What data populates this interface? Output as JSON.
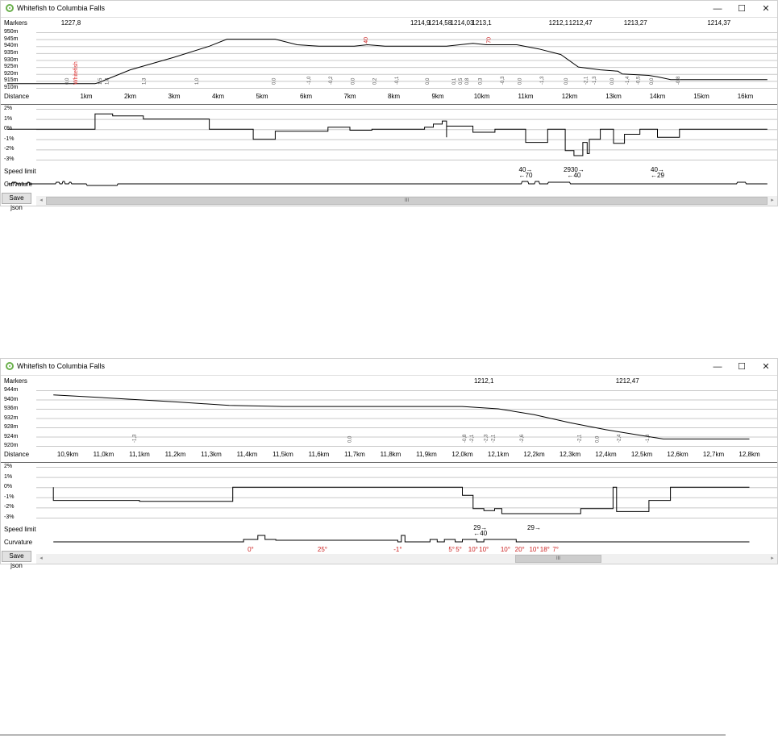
{
  "window_title": "Whitefish to Columbia Falls",
  "labels": {
    "markers": "Markers",
    "distance": "Distance",
    "speed_limit": "Speed limit",
    "curvature": "Curvature",
    "save": "Save json"
  },
  "controls": {
    "minimize": "—",
    "maximize": "☐",
    "close": "✕",
    "scroll_left": "◂",
    "scroll_right": "▸",
    "scroll_grip": "III"
  },
  "colors": {
    "line": "#000000",
    "annotation_red": "#cc2222",
    "grid": "#c8c8c8",
    "station_red": "#dd3333"
  },
  "panel_top": {
    "scroll_thumb_fraction": [
      0.0,
      1.0
    ],
    "markers": [
      {
        "label": "1227,8",
        "x": 0.65
      },
      {
        "label": "1214,9",
        "x": 8.6
      },
      {
        "label": "1214,58",
        "x": 9.05
      },
      {
        "label": "1214,03",
        "x": 9.55
      },
      {
        "label": "1213,1",
        "x": 10.0
      },
      {
        "label": "1212,1",
        "x": 11.75
      },
      {
        "label": "1212,47",
        "x": 12.25
      },
      {
        "label": "1213,27",
        "x": 13.5
      },
      {
        "label": "1214,37",
        "x": 15.4
      }
    ],
    "elev_ticks": [
      "950m",
      "945m",
      "940m",
      "935m",
      "930m",
      "925m",
      "920m",
      "915m",
      "910m"
    ],
    "dist_ticks": [
      "1km",
      "2km",
      "3km",
      "4km",
      "5km",
      "6km",
      "7km",
      "8km",
      "9km",
      "10km",
      "11km",
      "12km",
      "13km",
      "14km",
      "15km",
      "16km"
    ],
    "station": {
      "name": "Whitefish",
      "x": 0.8
    },
    "elevation_profile": [
      [
        -0.8,
        913
      ],
      [
        1.2,
        913
      ],
      [
        1.3,
        914
      ],
      [
        2.0,
        923
      ],
      [
        3.0,
        932
      ],
      [
        3.8,
        940
      ],
      [
        4.2,
        945
      ],
      [
        5.3,
        945
      ],
      [
        5.8,
        941
      ],
      [
        6.3,
        940
      ],
      [
        7.1,
        940
      ],
      [
        7.4,
        941
      ],
      [
        7.8,
        940
      ],
      [
        9.2,
        940
      ],
      [
        9.8,
        942
      ],
      [
        10.1,
        941
      ],
      [
        10.8,
        941
      ],
      [
        11.3,
        938
      ],
      [
        11.8,
        934
      ],
      [
        12.2,
        925
      ],
      [
        12.7,
        923
      ],
      [
        13.1,
        922
      ],
      [
        13.2,
        920
      ],
      [
        13.8,
        919
      ],
      [
        14.0,
        918
      ],
      [
        14.3,
        916
      ],
      [
        16.5,
        916
      ]
    ],
    "grade_labels": [
      {
        "x": 0.6,
        "t": "0,0"
      },
      {
        "x": 1.35,
        "t": "1,5"
      },
      {
        "x": 1.5,
        "t": "1,8"
      },
      {
        "x": 2.35,
        "t": "1,3"
      },
      {
        "x": 3.55,
        "t": "1,0"
      },
      {
        "x": 5.3,
        "t": "0,0"
      },
      {
        "x": 6.1,
        "t": "-1,0"
      },
      {
        "x": 6.6,
        "t": "-0,2"
      },
      {
        "x": 7.1,
        "t": "0,0"
      },
      {
        "x": 7.6,
        "t": "0,2"
      },
      {
        "x": 8.1,
        "t": "-0,1"
      },
      {
        "x": 8.8,
        "t": "0,0"
      },
      {
        "x": 9.4,
        "t": "0,1"
      },
      {
        "x": 9.55,
        "t": "0,5"
      },
      {
        "x": 9.7,
        "t": "0,8"
      },
      {
        "x": 10.0,
        "t": "0,3"
      },
      {
        "x": 10.5,
        "t": "-0,3"
      },
      {
        "x": 10.9,
        "t": "0,0"
      },
      {
        "x": 11.4,
        "t": "-1,3"
      },
      {
        "x": 11.95,
        "t": "0,0"
      },
      {
        "x": 12.4,
        "t": "-2,1"
      },
      {
        "x": 12.6,
        "t": "-1,3"
      },
      {
        "x": 13.0,
        "t": "0,0"
      },
      {
        "x": 13.35,
        "t": "-1,4"
      },
      {
        "x": 13.6,
        "t": "-0,5"
      },
      {
        "x": 13.9,
        "t": "0,0"
      },
      {
        "x": 14.5,
        "t": "-0,8"
      }
    ],
    "red_annotations": [
      {
        "x": 7.4,
        "t": "40"
      },
      {
        "x": 10.2,
        "t": "70"
      }
    ],
    "grade_ticks": [
      "2%",
      "1%",
      "0%",
      "-1%",
      "-2%",
      "-3%"
    ],
    "grade_profile": [
      [
        -0.8,
        0
      ],
      [
        1.2,
        0
      ],
      [
        1.2,
        1.5
      ],
      [
        1.6,
        1.5
      ],
      [
        1.6,
        1.3
      ],
      [
        2.3,
        1.3
      ],
      [
        2.3,
        1.0
      ],
      [
        3.8,
        1.0
      ],
      [
        3.8,
        0
      ],
      [
        4.8,
        0
      ],
      [
        4.8,
        -1.0
      ],
      [
        5.3,
        -1.0
      ],
      [
        5.3,
        -0.2
      ],
      [
        6.5,
        -0.2
      ],
      [
        6.5,
        0.2
      ],
      [
        7.0,
        0.2
      ],
      [
        7.0,
        -0.1
      ],
      [
        7.5,
        -0.1
      ],
      [
        7.5,
        0
      ],
      [
        8.7,
        0
      ],
      [
        8.7,
        0.2
      ],
      [
        8.9,
        0.2
      ],
      [
        8.9,
        0.5
      ],
      [
        9.1,
        0.5
      ],
      [
        9.1,
        0.8
      ],
      [
        9.2,
        0.8
      ],
      [
        9.2,
        -0.8
      ],
      [
        9.2,
        0.3
      ],
      [
        9.8,
        0.3
      ],
      [
        9.8,
        -0.3
      ],
      [
        10.3,
        -0.3
      ],
      [
        10.3,
        0
      ],
      [
        11.0,
        0
      ],
      [
        11.0,
        -1.3
      ],
      [
        11.5,
        -1.3
      ],
      [
        11.5,
        0
      ],
      [
        11.9,
        0
      ],
      [
        11.9,
        -2.1
      ],
      [
        12.1,
        -2.1
      ],
      [
        12.1,
        -2.6
      ],
      [
        12.3,
        -2.6
      ],
      [
        12.3,
        -1.3
      ],
      [
        12.4,
        -1.3
      ],
      [
        12.4,
        -2.4
      ],
      [
        12.45,
        -2.4
      ],
      [
        12.45,
        -1.0
      ],
      [
        12.7,
        -1.0
      ],
      [
        12.7,
        0
      ],
      [
        13.0,
        0
      ],
      [
        13.0,
        -1.4
      ],
      [
        13.25,
        -1.4
      ],
      [
        13.25,
        -0.5
      ],
      [
        13.6,
        -0.5
      ],
      [
        13.6,
        0
      ],
      [
        14.0,
        0
      ],
      [
        14.0,
        -0.8
      ],
      [
        14.5,
        -0.8
      ],
      [
        14.5,
        0
      ],
      [
        16.5,
        0
      ]
    ],
    "speed_limits": [
      {
        "x": 11.0,
        "a": "40→",
        "b": "←70"
      },
      {
        "x": 12.1,
        "a": "2930→",
        "b": "←40"
      },
      {
        "x": 14.0,
        "a": "40→",
        "b": "←29"
      }
    ],
    "curvature_profile": [
      [
        -0.8,
        0
      ],
      [
        -0.7,
        0
      ],
      [
        -0.68,
        -2
      ],
      [
        -0.6,
        -2
      ],
      [
        -0.58,
        0
      ],
      [
        -0.35,
        0
      ],
      [
        -0.33,
        -2
      ],
      [
        -0.3,
        -2
      ],
      [
        -0.28,
        0
      ],
      [
        0.3,
        0
      ],
      [
        0.32,
        -2
      ],
      [
        0.38,
        -2
      ],
      [
        0.4,
        0
      ],
      [
        0.45,
        0
      ],
      [
        0.47,
        -3
      ],
      [
        0.5,
        -3
      ],
      [
        0.52,
        0
      ],
      [
        0.6,
        0
      ],
      [
        0.62,
        -2
      ],
      [
        0.65,
        -2
      ],
      [
        0.67,
        0
      ],
      [
        1.0,
        0
      ],
      [
        1.02,
        2
      ],
      [
        1.7,
        2
      ],
      [
        1.72,
        0
      ],
      [
        10.9,
        0
      ],
      [
        10.92,
        -3
      ],
      [
        11.05,
        -3
      ],
      [
        11.07,
        0
      ],
      [
        11.2,
        0
      ],
      [
        11.22,
        -3
      ],
      [
        11.3,
        -3
      ],
      [
        11.32,
        0
      ],
      [
        11.5,
        0
      ],
      [
        11.52,
        -2
      ],
      [
        12.0,
        -2
      ],
      [
        12.02,
        0
      ],
      [
        15.8,
        0
      ],
      [
        15.82,
        -2
      ],
      [
        16.0,
        -2
      ],
      [
        16.02,
        0
      ],
      [
        16.5,
        0
      ]
    ]
  },
  "panel_bottom": {
    "scroll_thumb_fraction": [
      0.65,
      0.77
    ],
    "markers": [
      {
        "label": "1212,1",
        "x": 12.06
      },
      {
        "label": "1212,47",
        "x": 12.46
      }
    ],
    "elev_ticks": [
      "944m",
      "940m",
      "936m",
      "932m",
      "928m",
      "924m",
      "920m"
    ],
    "dist_ticks": [
      "10,9km",
      "11,0km",
      "11,1km",
      "11,2km",
      "11,3km",
      "11,4km",
      "11,5km",
      "11,6km",
      "11,7km",
      "11,8km",
      "11,9km",
      "12,0km",
      "12,1km",
      "12,2km",
      "12,3km",
      "12,4km",
      "12,5km",
      "12,6km",
      "12,7km",
      "12,8km"
    ],
    "elevation_profile": [
      [
        10.86,
        942
      ],
      [
        11.0,
        940.8
      ],
      [
        11.2,
        939
      ],
      [
        11.35,
        937.5
      ],
      [
        11.5,
        937
      ],
      [
        12.0,
        937
      ],
      [
        12.1,
        936
      ],
      [
        12.2,
        933.5
      ],
      [
        12.3,
        930
      ],
      [
        12.4,
        927
      ],
      [
        12.5,
        924.5
      ],
      [
        12.56,
        923
      ],
      [
        12.8,
        923
      ]
    ],
    "grade_labels": [
      {
        "x": 11.09,
        "t": "-1,3"
      },
      {
        "x": 11.69,
        "t": "0,0"
      },
      {
        "x": 12.01,
        "t": "-0,8"
      },
      {
        "x": 12.03,
        "t": "-2,1"
      },
      {
        "x": 12.07,
        "t": "-2,3"
      },
      {
        "x": 12.09,
        "t": "-2,1"
      },
      {
        "x": 12.17,
        "t": "-2,6"
      },
      {
        "x": 12.33,
        "t": "-2,1"
      },
      {
        "x": 12.38,
        "t": "0,0"
      },
      {
        "x": 12.44,
        "t": "-2,4"
      },
      {
        "x": 12.52,
        "t": "-1,3"
      }
    ],
    "grade_ticks": [
      "2%",
      "1%",
      "0%",
      "-1%",
      "-2%",
      "-3%"
    ],
    "grade_profile": [
      [
        10.86,
        0
      ],
      [
        10.86,
        -1.3
      ],
      [
        11.1,
        -1.3
      ],
      [
        11.1,
        -1.4
      ],
      [
        11.36,
        -1.4
      ],
      [
        11.36,
        0
      ],
      [
        12.0,
        0
      ],
      [
        12.0,
        -0.8
      ],
      [
        12.03,
        -0.8
      ],
      [
        12.03,
        -2.1
      ],
      [
        12.06,
        -2.1
      ],
      [
        12.06,
        -2.3
      ],
      [
        12.09,
        -2.3
      ],
      [
        12.09,
        -2.1
      ],
      [
        12.11,
        -2.1
      ],
      [
        12.11,
        -2.6
      ],
      [
        12.33,
        -2.6
      ],
      [
        12.33,
        -2.1
      ],
      [
        12.42,
        -2.1
      ],
      [
        12.42,
        0
      ],
      [
        12.43,
        0
      ],
      [
        12.43,
        -2.4
      ],
      [
        12.52,
        -2.4
      ],
      [
        12.52,
        -1.3
      ],
      [
        12.58,
        -1.3
      ],
      [
        12.58,
        0
      ],
      [
        12.8,
        0
      ]
    ],
    "speed_limits": [
      {
        "x": 12.05,
        "a": "29→",
        "b": "←40"
      },
      {
        "x": 12.2,
        "a": "29→",
        "b": ""
      }
    ],
    "curvature_profile": [
      [
        10.86,
        0
      ],
      [
        11.39,
        0
      ],
      [
        11.39,
        -3
      ],
      [
        11.43,
        -3
      ],
      [
        11.43,
        -8
      ],
      [
        11.45,
        -8
      ],
      [
        11.45,
        -3
      ],
      [
        11.48,
        -3
      ],
      [
        11.48,
        -2
      ],
      [
        11.6,
        -2
      ],
      [
        11.6,
        -2
      ],
      [
        11.82,
        -2
      ],
      [
        11.82,
        0
      ],
      [
        11.83,
        0
      ],
      [
        11.83,
        -8
      ],
      [
        11.84,
        -8
      ],
      [
        11.84,
        0
      ],
      [
        11.91,
        0
      ],
      [
        11.91,
        -3
      ],
      [
        11.93,
        -3
      ],
      [
        11.93,
        0
      ],
      [
        11.95,
        0
      ],
      [
        11.95,
        -3
      ],
      [
        11.98,
        -3
      ],
      [
        11.98,
        0
      ],
      [
        12.0,
        0
      ],
      [
        12.0,
        -3
      ],
      [
        12.04,
        -3
      ],
      [
        12.04,
        0
      ],
      [
        12.06,
        0
      ],
      [
        12.06,
        -3
      ],
      [
        12.08,
        -3
      ],
      [
        12.08,
        -3
      ],
      [
        12.15,
        -3
      ],
      [
        12.15,
        0
      ],
      [
        12.8,
        0
      ]
    ],
    "curvature_labels": [
      {
        "x": 11.41,
        "t": "0°"
      },
      {
        "x": 11.61,
        "t": "25°"
      },
      {
        "x": 11.82,
        "t": "-1°"
      },
      {
        "x": 11.97,
        "t": "5°"
      },
      {
        "x": 11.99,
        "t": "5°"
      },
      {
        "x": 12.03,
        "t": "10°"
      },
      {
        "x": 12.06,
        "t": "10°"
      },
      {
        "x": 12.12,
        "t": "10°"
      },
      {
        "x": 12.16,
        "t": "20°"
      },
      {
        "x": 12.2,
        "t": "10°"
      },
      {
        "x": 12.23,
        "t": "18°"
      },
      {
        "x": 12.26,
        "t": "7°"
      }
    ]
  }
}
